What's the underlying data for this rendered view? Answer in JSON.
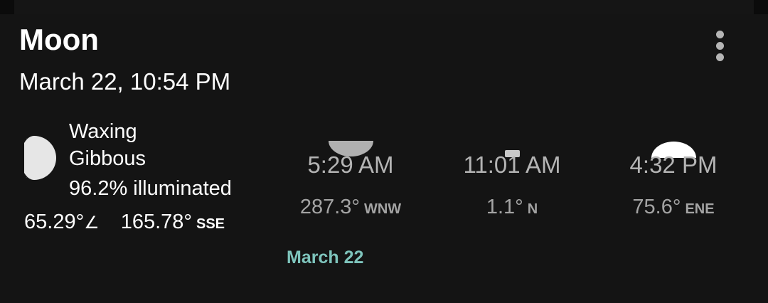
{
  "card": {
    "title": "Moon",
    "datetime": "March 22, 10:54 PM",
    "menu_icon": "more-vert-icon"
  },
  "current": {
    "phase_line1": "Waxing",
    "phase_line2": "Gibbous",
    "illumination": "96.2% illuminated",
    "altitude": "65.29°",
    "altitude_icon": "angle-icon",
    "angle_glyph": "∠",
    "azimuth": "165.78°",
    "azimuth_dir": "SSE",
    "phase_icon": "moon-phase-icon"
  },
  "events": [
    {
      "time": "5:29 AM",
      "azimuth": "287.3°",
      "direction": "WNW",
      "icon": "moonset-icon"
    },
    {
      "time": "11:01 AM",
      "azimuth": "1.1°",
      "direction": "N",
      "icon": "moon-transit-icon"
    },
    {
      "time": "4:32 PM",
      "azimuth": "75.6°",
      "direction": "ENE",
      "icon": "moonrise-icon"
    }
  ],
  "date_link": "March 22",
  "colors": {
    "background": "#141414",
    "text_primary": "#ffffff",
    "text_secondary": "#b4b4b4",
    "accent": "#7ec4bc"
  }
}
